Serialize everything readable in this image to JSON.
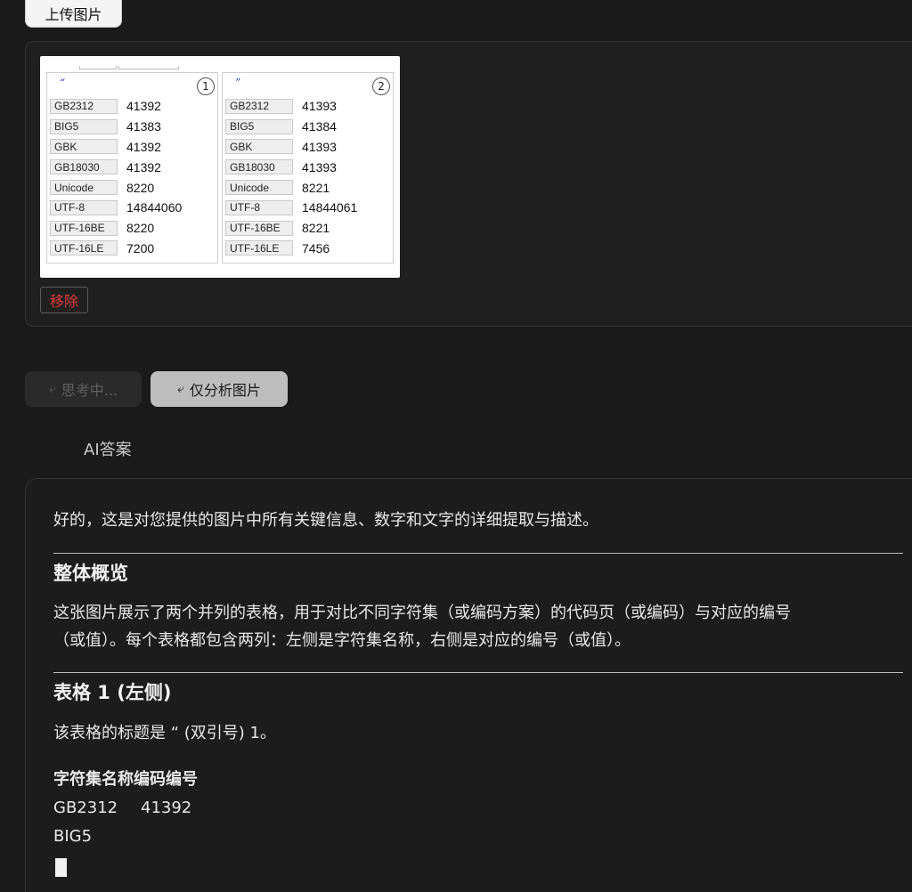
{
  "upload": {
    "label": "上传图片"
  },
  "thumbnail": {
    "tables": [
      {
        "char": "“",
        "number": "1",
        "rows": [
          {
            "name": "GB2312",
            "value": "41392"
          },
          {
            "name": "BIG5",
            "value": "41383"
          },
          {
            "name": "GBK",
            "value": "41392"
          },
          {
            "name": "GB18030",
            "value": "41392"
          },
          {
            "name": "Unicode",
            "value": "8220"
          },
          {
            "name": "UTF-8",
            "value": "14844060"
          },
          {
            "name": "UTF-16BE",
            "value": "8220"
          },
          {
            "name": "UTF-16LE",
            "value": "7200"
          }
        ]
      },
      {
        "char": "”",
        "number": "2",
        "rows": [
          {
            "name": "GB2312",
            "value": "41393"
          },
          {
            "name": "BIG5",
            "value": "41384"
          },
          {
            "name": "GBK",
            "value": "41393"
          },
          {
            "name": "GB18030",
            "value": "41393"
          },
          {
            "name": "Unicode",
            "value": "8221"
          },
          {
            "name": "UTF-8",
            "value": "14844061"
          },
          {
            "name": "UTF-16BE",
            "value": "8221"
          },
          {
            "name": "UTF-16LE",
            "value": "7456"
          }
        ]
      }
    ]
  },
  "remove": {
    "label": "移除"
  },
  "actions": {
    "thinking_label": "思考中...",
    "analyze_label": "仅分析图片",
    "spinner_icon": "spinner-icon"
  },
  "answer": {
    "section_label": "AI答案",
    "intro": "好的，这是对您提供的图片中所有关键信息、数字和文字的详细提取与描述。",
    "overview_heading": "整体概览",
    "overview_line1": "这张图片展示了两个并列的表格，用于对比不同字符集（或编码方案）的代码页（或编码）与对应的编号",
    "overview_line2": "（或值）。每个表格都包含两列：左侧是字符集名称，右侧是对应的编号（或值）。",
    "table1_heading": "表格 1 (左侧)",
    "table1_title": "该表格的标题是 “ (双引号) 1。",
    "col_heading": "字符集名称编码编号",
    "row1_name": "GB2312",
    "row1_value": "41392",
    "row2_name": "BIG5"
  },
  "colors": {
    "background": "#1a1a1a",
    "remove_text": "#e23b3b",
    "char_blue": "#1a3fd0"
  }
}
